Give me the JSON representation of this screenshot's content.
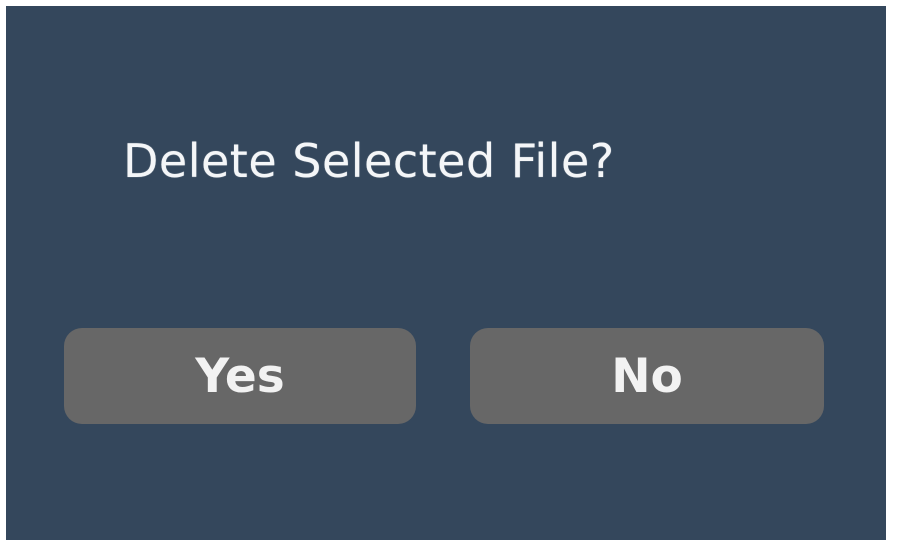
{
  "dialog": {
    "title": "Delete Selected File?",
    "yes_label": "Yes",
    "no_label": "No"
  },
  "colors": {
    "dialog_background": "#34475c",
    "button_background": "#676767",
    "text": "#f4f6f8"
  }
}
